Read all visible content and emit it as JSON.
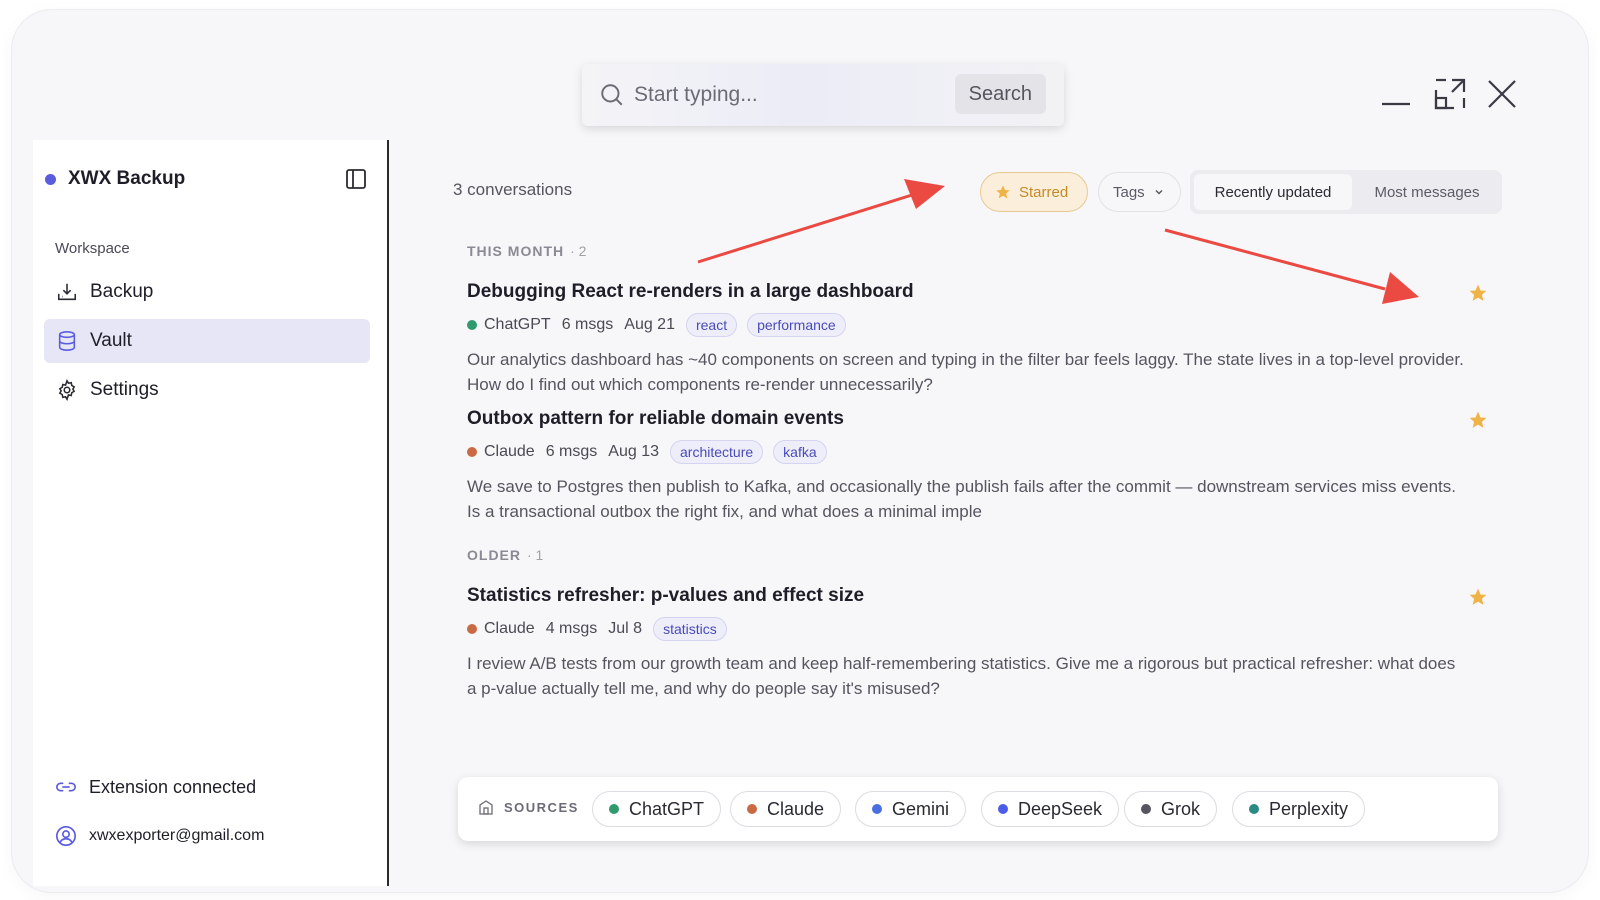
{
  "search": {
    "placeholder": "Start typing...",
    "button_label": "Search"
  },
  "sidebar": {
    "brand": "XWX Backup",
    "section_label": "Workspace",
    "items": [
      {
        "label": "Backup",
        "icon": "download-icon"
      },
      {
        "label": "Vault",
        "icon": "database-icon",
        "active": true
      },
      {
        "label": "Settings",
        "icon": "gear-icon"
      }
    ],
    "footer": {
      "extension": "Extension connected",
      "email": "xwxexporter@gmail.com"
    }
  },
  "toolbar": {
    "count": "3 conversations",
    "starred_label": "Starred",
    "tags_label": "Tags",
    "sort_recent": "Recently updated",
    "sort_most": "Most messages"
  },
  "sections": [
    {
      "label": "THIS MONTH",
      "count": "· 2",
      "conversations": [
        {
          "title": "Debugging React re-renders in a large dashboard",
          "source": "ChatGPT",
          "source_color": "#2f9a6e",
          "msgs": "6 msgs",
          "date": "Aug 21",
          "tags": [
            "react",
            "performance"
          ],
          "preview": "Our analytics dashboard has ~40 components on screen and typing in the filter bar feels laggy. The state lives in a top-level provider. How do I find out which components re-render unnecessarily?",
          "starred": true
        },
        {
          "title": "Outbox pattern for reliable domain events",
          "source": "Claude",
          "source_color": "#c96a45",
          "msgs": "6 msgs",
          "date": "Aug 13",
          "tags": [
            "architecture",
            "kafka"
          ],
          "preview": "We save to Postgres then publish to Kafka, and occasionally the publish fails after the commit — downstream services miss events. Is a transactional outbox the right fix, and what does a minimal imple",
          "starred": true
        }
      ]
    },
    {
      "label": "OLDER",
      "count": "· 1",
      "conversations": [
        {
          "title": "Statistics refresher: p-values and effect size",
          "source": "Claude",
          "source_color": "#c96a45",
          "msgs": "4 msgs",
          "date": "Jul 8",
          "tags": [
            "statistics"
          ],
          "preview": "I review A/B tests from our growth team and keep half-remembering statistics. Give me a rigorous but practical refresher: what does a p-value actually tell me, and why do people say it's misused?",
          "starred": true
        }
      ]
    }
  ],
  "sources_bar": {
    "label": "SOURCES",
    "items": [
      {
        "name": "ChatGPT",
        "color": "#2f9a6e"
      },
      {
        "name": "Claude",
        "color": "#c96a45"
      },
      {
        "name": "Gemini",
        "color": "#4a6fe0"
      },
      {
        "name": "DeepSeek",
        "color": "#4c5ce8"
      },
      {
        "name": "Grok",
        "color": "#55555f"
      },
      {
        "name": "Perplexity",
        "color": "#2a8a84"
      }
    ]
  },
  "colors": {
    "accent": "#5b5be0",
    "star": "#f0b347",
    "annotation_arrow": "#ea4a42"
  }
}
